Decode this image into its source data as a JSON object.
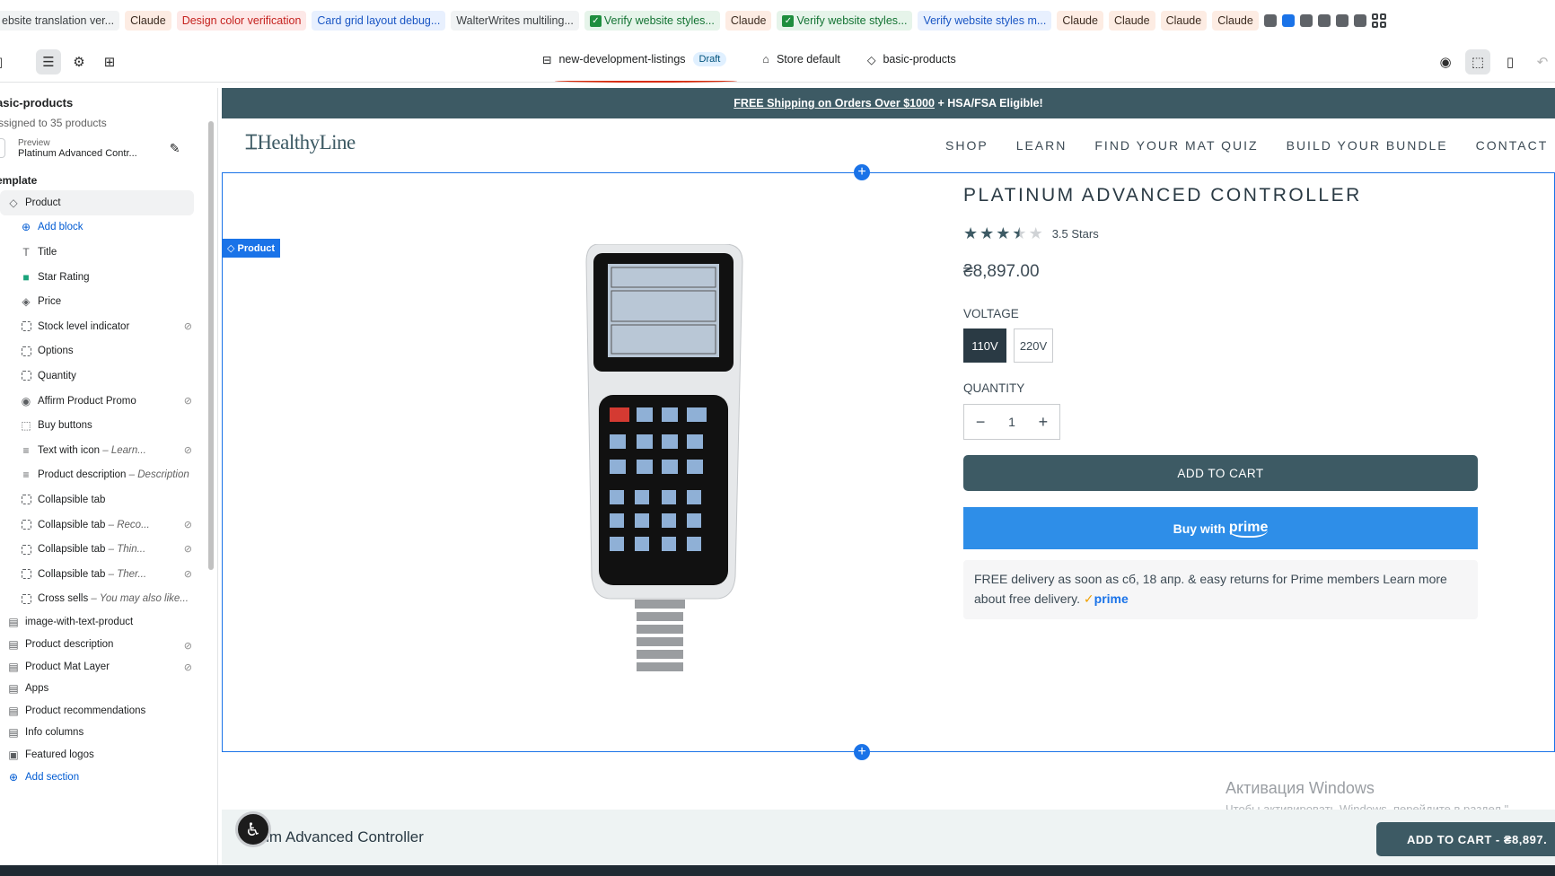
{
  "bookmarks": [
    {
      "label": "ebsite translation ver...",
      "style": "gray",
      "check": false
    },
    {
      "label": "Claude",
      "style": "orange",
      "check": false
    },
    {
      "label": "Design color verification",
      "style": "red",
      "check": false
    },
    {
      "label": "Card grid layout debug...",
      "style": "blue",
      "check": false
    },
    {
      "label": "WalterWrites multiling...",
      "style": "gray",
      "check": false
    },
    {
      "label": "Verify website styles...",
      "style": "green",
      "check": true
    },
    {
      "label": "Claude",
      "style": "orange",
      "check": false
    },
    {
      "label": "Verify website styles...",
      "style": "green",
      "check": true
    },
    {
      "label": "Verify website styles m...",
      "style": "blue",
      "check": false
    },
    {
      "label": "Claude",
      "style": "orange",
      "check": false
    },
    {
      "label": "Claude",
      "style": "orange",
      "check": false
    },
    {
      "label": "Claude",
      "style": "orange",
      "check": false
    },
    {
      "label": "Claude",
      "style": "orange",
      "check": false
    }
  ],
  "toolbar": {
    "template_name": "new-development-listings",
    "status_badge": "Draft",
    "store": "Store default",
    "product_template": "basic-products"
  },
  "sidebar": {
    "title": "asic-products",
    "subtitle": "ssigned to 35 products",
    "preview_label": "Preview",
    "preview_value": "Platinum Advanced Contr...",
    "section_label": "emplate",
    "rows": [
      {
        "label": "Product",
        "sub": "",
        "icon": "tag-icon",
        "level": "l1",
        "sel": true,
        "link": false,
        "hidden": false
      },
      {
        "label": "Add block",
        "sub": "",
        "icon": "plus-circle-icon",
        "level": "l2",
        "sel": false,
        "link": true,
        "hidden": false
      },
      {
        "label": "Title",
        "sub": "",
        "icon": "text-icon",
        "level": "l2",
        "sel": false,
        "link": false,
        "hidden": false
      },
      {
        "label": "Star Rating",
        "sub": "",
        "icon": "app-icon",
        "level": "l2",
        "sel": false,
        "link": false,
        "hidden": false
      },
      {
        "label": "Price",
        "sub": "",
        "icon": "price-tag-icon",
        "level": "l2",
        "sel": false,
        "link": false,
        "hidden": false
      },
      {
        "label": "Stock level indicator",
        "sub": "",
        "icon": "block-icon",
        "level": "l2",
        "sel": false,
        "link": false,
        "hidden": true
      },
      {
        "label": "Options",
        "sub": "",
        "icon": "block-icon",
        "level": "l2",
        "sel": false,
        "link": false,
        "hidden": false
      },
      {
        "label": "Quantity",
        "sub": "",
        "icon": "block-icon",
        "level": "l2",
        "sel": false,
        "link": false,
        "hidden": false
      },
      {
        "label": "Affirm Product Promo",
        "sub": "",
        "icon": "app-circle-icon",
        "level": "l2",
        "sel": false,
        "link": false,
        "hidden": true
      },
      {
        "label": "Buy buttons",
        "sub": "",
        "icon": "cursor-icon",
        "level": "l2",
        "sel": false,
        "link": false,
        "hidden": false
      },
      {
        "label": "Text with icon",
        "sub": " – Learn...",
        "icon": "lines-icon",
        "level": "l2",
        "sel": false,
        "link": false,
        "hidden": true
      },
      {
        "label": "Product description",
        "sub": " – Description",
        "icon": "lines-icon",
        "level": "l2",
        "sel": false,
        "link": false,
        "hidden": false
      },
      {
        "label": "Collapsible tab",
        "sub": "",
        "icon": "block-icon",
        "level": "l2",
        "sel": false,
        "link": false,
        "hidden": false
      },
      {
        "label": "Collapsible tab",
        "sub": " – Reco...",
        "icon": "block-icon",
        "level": "l2",
        "sel": false,
        "link": false,
        "hidden": true
      },
      {
        "label": "Collapsible tab",
        "sub": " – Thin...",
        "icon": "block-icon",
        "level": "l2",
        "sel": false,
        "link": false,
        "hidden": true
      },
      {
        "label": "Collapsible tab",
        "sub": " – Ther...",
        "icon": "block-icon",
        "level": "l2",
        "sel": false,
        "link": false,
        "hidden": true
      },
      {
        "label": "Cross sells",
        "sub": " – You may also like...",
        "icon": "block-icon",
        "level": "l2",
        "sel": false,
        "link": false,
        "hidden": false
      },
      {
        "label": "image-with-text-product",
        "sub": "",
        "icon": "section-icon",
        "level": "l1",
        "sel": false,
        "link": false,
        "hidden": false
      },
      {
        "label": "Product description",
        "sub": "",
        "icon": "section-icon",
        "level": "l1",
        "sel": false,
        "link": false,
        "hidden": true
      },
      {
        "label": "Product Mat Layer",
        "sub": "",
        "icon": "section-icon",
        "level": "l1",
        "sel": false,
        "link": false,
        "hidden": true
      },
      {
        "label": "Apps",
        "sub": "",
        "icon": "section-icon",
        "level": "l1",
        "sel": false,
        "link": false,
        "hidden": false
      },
      {
        "label": "Product recommendations",
        "sub": "",
        "icon": "section-icon",
        "level": "l1",
        "sel": false,
        "link": false,
        "hidden": false
      },
      {
        "label": "Info columns",
        "sub": "",
        "icon": "section-icon",
        "level": "l1",
        "sel": false,
        "link": false,
        "hidden": false
      },
      {
        "label": "Featured logos",
        "sub": "",
        "icon": "image-icon",
        "level": "l1",
        "sel": false,
        "link": false,
        "hidden": false
      },
      {
        "label": "Add section",
        "sub": "",
        "icon": "plus-circle-icon",
        "level": "l1",
        "sel": false,
        "link": true,
        "hidden": false
      }
    ]
  },
  "store": {
    "announcement_bold": "FREE Shipping on Orders Over $1000",
    "announcement_rest": " + HSA/FSA Eligible!",
    "logo": "HealthyLine",
    "nav": [
      "SHOP",
      "LEARN",
      "FIND YOUR MAT QUIZ",
      "BUILD YOUR BUNDLE",
      "CONTACT"
    ],
    "product_tag": "Product",
    "product_title": "PLATINUM ADVANCED CONTROLLER",
    "rating": 3.5,
    "rating_text": "3.5 Stars",
    "price": "₴8,897.00",
    "voltage_label": "VOLTAGE",
    "voltage_options": [
      "110V",
      "220V"
    ],
    "quantity_label": "QUANTITY",
    "quantity": "1",
    "add_to_cart": "ADD TO CART",
    "prime_button_pre": "Buy with ",
    "prime_button_word": "prime",
    "prime_note": "FREE delivery as soon as сб, 18 апр. & easy returns for Prime members Learn more about free delivery.",
    "prime_word": "prime",
    "sticky_name": "num Advanced Controller",
    "sticky_atc": "ADD TO CART  - ₴8,897.",
    "watermark_title": "Активация Windows",
    "watermark_sub": "Чтобы активировать Windows, перейдите в раздел \"..."
  },
  "colors": {
    "brand": "#3d5a64",
    "selection": "#1a73e8",
    "prime": "#2e8ee8"
  }
}
